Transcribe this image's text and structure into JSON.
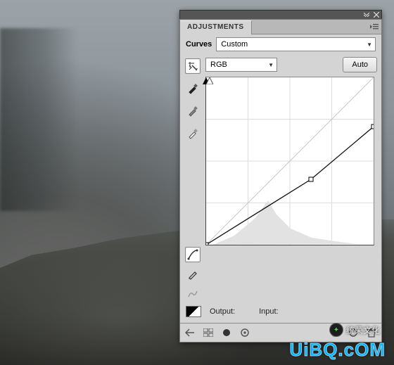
{
  "panel": {
    "tab": "ADJUSTMENTS",
    "type_label": "Curves",
    "preset": "Custom",
    "channel": "RGB",
    "auto_label": "Auto",
    "output_label": "Output:",
    "input_label": "Input:"
  },
  "icons": {
    "point_tool": "targeted-adjustment-icon",
    "eyedrop_black": "black-point-eyedropper-icon",
    "eyedrop_gray": "gray-point-eyedropper-icon",
    "eyedrop_white": "white-point-eyedropper-icon",
    "curve_mode": "curve-point-mode-icon",
    "pencil_mode": "pencil-mode-icon",
    "smooth": "smooth-curve-icon",
    "collapse": "collapse-icon",
    "close": "close-icon",
    "menu": "panel-menu-icon",
    "swatch": "gradient-swatch-icon",
    "back": "back-arrow-icon",
    "new_adj": "adjustment-list-icon",
    "expand": "expanded-view-icon",
    "clip": "clip-to-layer-icon",
    "eye": "toggle-visibility-icon",
    "prev": "view-previous-icon",
    "reset": "reset-icon",
    "trash": "delete-icon"
  },
  "chart_data": {
    "type": "line",
    "title": "Curves",
    "xlabel": "Input",
    "ylabel": "Output",
    "xlim": [
      0,
      255
    ],
    "ylim": [
      0,
      255
    ],
    "grid": true,
    "series": [
      {
        "name": "baseline",
        "x": [
          0,
          255
        ],
        "y": [
          0,
          255
        ]
      },
      {
        "name": "curve",
        "x": [
          0,
          160,
          255
        ],
        "y": [
          0,
          100,
          180
        ]
      }
    ],
    "histogram_peak_input": 95,
    "histogram_range": [
      10,
      230
    ]
  },
  "watermark": {
    "main": "UiBQ.cOM",
    "sub": "统荣文化"
  }
}
